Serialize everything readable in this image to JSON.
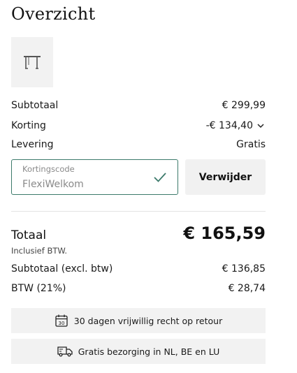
{
  "summary": {
    "title": "Overzicht",
    "product_thumb_icon": "desk-frame-icon",
    "subtotal_label": "Subtotaal",
    "subtotal_value": "€ 299,99",
    "discount_label": "Korting",
    "discount_value": "-€ 134,40",
    "delivery_label": "Levering",
    "delivery_value": "Gratis"
  },
  "coupon": {
    "label": "Kortingscode",
    "value": "FlexiWelkom",
    "status_icon": "check-icon",
    "remove_label": "Verwijder"
  },
  "totals": {
    "total_label": "Totaal",
    "total_value": "€ 165,59",
    "incl_vat": "Inclusief BTW.",
    "subtotal_excl_label": "Subtotaal (excl. btw)",
    "subtotal_excl_value": "€ 136,85",
    "vat_label": "BTW (21%)",
    "vat_value": "€ 28,74"
  },
  "benefits": [
    {
      "icon": "calendar-30-icon",
      "text": "30 dagen vrijwillig recht op retour"
    },
    {
      "icon": "delivery-truck-icon",
      "text": "Gratis bezorging in NL, BE en LU"
    }
  ],
  "colors": {
    "accent": "#3c7a6b",
    "box_bg": "#f2f2f2",
    "text": "#1a1a1a"
  }
}
